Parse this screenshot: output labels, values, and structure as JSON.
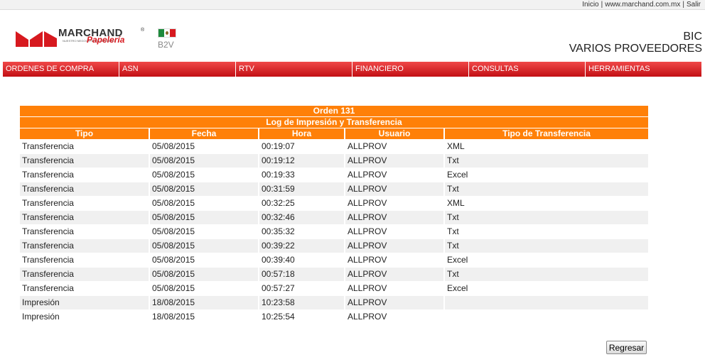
{
  "toplinks": {
    "inicio": "Inicio",
    "site": "www.marchand.com.mx",
    "salir": "Salir",
    "sep": "|"
  },
  "logo": {
    "brand": "MARCHAND",
    "reg": "®",
    "sub": "Papelería",
    "tagline": "NUESTRO NEGOCIO ES SU NEGOCIO"
  },
  "portal": {
    "label": "B2V"
  },
  "company": {
    "line1": "BIC",
    "line2": "VARIOS PROVEEDORES"
  },
  "nav": [
    {
      "label": "ORDENES DE COMPRA"
    },
    {
      "label": "ASN"
    },
    {
      "label": "RTV"
    },
    {
      "label": "FINANCIERO"
    },
    {
      "label": "CONSULTAS"
    },
    {
      "label": "HERRAMIENTAS"
    }
  ],
  "log": {
    "title": "Orden 131",
    "subtitle": "Log de Impresión y Transferencia",
    "columns": [
      "Tipo",
      "Fecha",
      "Hora",
      "Usuario",
      "Tipo de Transferencia"
    ],
    "rows": [
      [
        "Transferencia",
        "05/08/2015",
        "00:19:07",
        "ALLPROV",
        "XML"
      ],
      [
        "Transferencia",
        "05/08/2015",
        "00:19:12",
        "ALLPROV",
        "Txt"
      ],
      [
        "Transferencia",
        "05/08/2015",
        "00:19:33",
        "ALLPROV",
        "Excel"
      ],
      [
        "Transferencia",
        "05/08/2015",
        "00:31:59",
        "ALLPROV",
        "Txt"
      ],
      [
        "Transferencia",
        "05/08/2015",
        "00:32:25",
        "ALLPROV",
        "XML"
      ],
      [
        "Transferencia",
        "05/08/2015",
        "00:32:46",
        "ALLPROV",
        "Txt"
      ],
      [
        "Transferencia",
        "05/08/2015",
        "00:35:32",
        "ALLPROV",
        "Txt"
      ],
      [
        "Transferencia",
        "05/08/2015",
        "00:39:22",
        "ALLPROV",
        "Txt"
      ],
      [
        "Transferencia",
        "05/08/2015",
        "00:39:40",
        "ALLPROV",
        "Excel"
      ],
      [
        "Transferencia",
        "05/08/2015",
        "00:57:18",
        "ALLPROV",
        "Txt"
      ],
      [
        "Transferencia",
        "05/08/2015",
        "00:57:27",
        "ALLPROV",
        "Excel"
      ],
      [
        "Impresión",
        "18/08/2015",
        "10:23:58",
        "ALLPROV",
        ""
      ],
      [
        "Impresión",
        "18/08/2015",
        "10:25:54",
        "ALLPROV",
        ""
      ]
    ]
  },
  "actions": {
    "back_label": "Regresar"
  },
  "colors": {
    "header_orange": "#ff8008",
    "nav_red": "#d7191f",
    "row_alt": "#f0f0f0"
  }
}
